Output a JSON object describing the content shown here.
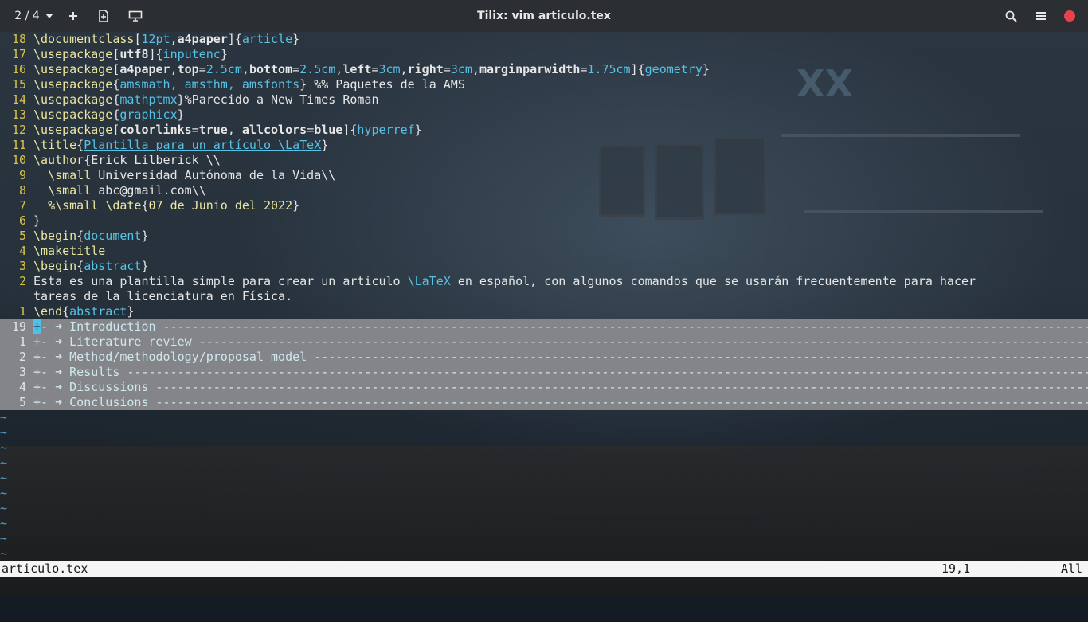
{
  "titlebar": {
    "tab_indicator": "2 / 4",
    "title": "Tilix: vim articulo.tex",
    "icons": [
      "chevron-down-icon",
      "plus-icon",
      "new-session-icon",
      "sync-icon",
      "search-icon",
      "menu-icon",
      "close-icon"
    ],
    "close_color": "#e8424a"
  },
  "editor": {
    "lines": [
      {
        "n": "18",
        "segs": [
          [
            "kw",
            "\\documentclass"
          ],
          [
            "t",
            "["
          ],
          [
            "arg",
            "12pt"
          ],
          [
            "t",
            ","
          ],
          [
            "bold",
            "a4paper"
          ],
          [
            "t",
            "]{"
          ],
          [
            "arg",
            "article"
          ],
          [
            "t",
            "}"
          ]
        ]
      },
      {
        "n": "17",
        "segs": [
          [
            "kw",
            "\\usepackage"
          ],
          [
            "t",
            "["
          ],
          [
            "bold",
            "utf8"
          ],
          [
            "t",
            "]{"
          ],
          [
            "arg",
            "inputenc"
          ],
          [
            "t",
            "}"
          ]
        ]
      },
      {
        "n": "16",
        "segs": [
          [
            "kw",
            "\\usepackage"
          ],
          [
            "t",
            "["
          ],
          [
            "bold",
            "a4paper"
          ],
          [
            "t",
            ","
          ],
          [
            "bold",
            "top"
          ],
          [
            "t",
            "="
          ],
          [
            "num",
            "2.5cm"
          ],
          [
            "t",
            ","
          ],
          [
            "bold",
            "bottom"
          ],
          [
            "t",
            "="
          ],
          [
            "num",
            "2.5cm"
          ],
          [
            "t",
            ","
          ],
          [
            "bold",
            "left"
          ],
          [
            "t",
            "="
          ],
          [
            "num",
            "3cm"
          ],
          [
            "t",
            ","
          ],
          [
            "bold",
            "right"
          ],
          [
            "t",
            "="
          ],
          [
            "num",
            "3cm"
          ],
          [
            "t",
            ","
          ],
          [
            "bold",
            "marginparwidth"
          ],
          [
            "t",
            "="
          ],
          [
            "num",
            "1.75cm"
          ],
          [
            "t",
            "]{"
          ],
          [
            "arg",
            "geometry"
          ],
          [
            "t",
            "}"
          ]
        ]
      },
      {
        "n": "15",
        "segs": [
          [
            "kw",
            "\\usepackage"
          ],
          [
            "t",
            "{"
          ],
          [
            "arg",
            "amsmath, amsthm, amsfonts"
          ],
          [
            "t",
            "} %% Paquetes de la AMS"
          ]
        ]
      },
      {
        "n": "14",
        "segs": [
          [
            "kw",
            "\\usepackage"
          ],
          [
            "t",
            "{"
          ],
          [
            "arg",
            "mathptmx"
          ],
          [
            "t",
            "}%Parecido a New Times Roman"
          ]
        ]
      },
      {
        "n": "13",
        "segs": [
          [
            "kw",
            "\\usepackage"
          ],
          [
            "t",
            "{"
          ],
          [
            "arg",
            "graphicx"
          ],
          [
            "t",
            "}"
          ]
        ]
      },
      {
        "n": "12",
        "segs": [
          [
            "kw",
            "\\usepackage"
          ],
          [
            "t",
            "["
          ],
          [
            "bold",
            "colorlinks"
          ],
          [
            "t",
            "="
          ],
          [
            "bold",
            "true"
          ],
          [
            "t",
            ", "
          ],
          [
            "bold",
            "allcolors"
          ],
          [
            "t",
            "="
          ],
          [
            "bold",
            "blue"
          ],
          [
            "t",
            "]{"
          ],
          [
            "arg",
            "hyperref"
          ],
          [
            "t",
            "}"
          ]
        ]
      },
      {
        "n": "11",
        "segs": [
          [
            "kw",
            "\\title"
          ],
          [
            "t",
            "{"
          ],
          [
            "link",
            "Plantilla para un artículo "
          ],
          [
            "link",
            "\\LaTeX"
          ],
          [
            "t",
            "}"
          ]
        ]
      },
      {
        "n": "10",
        "segs": [
          [
            "kw",
            "\\author"
          ],
          [
            "t",
            "{Erick Lilberick \\\\"
          ]
        ]
      },
      {
        "n": "9",
        "segs": [
          [
            "t",
            "  "
          ],
          [
            "kw",
            "\\small"
          ],
          [
            "t",
            " Universidad Autónoma de la Vida\\\\"
          ]
        ]
      },
      {
        "n": "8",
        "segs": [
          [
            "t",
            "  "
          ],
          [
            "kw",
            "\\small"
          ],
          [
            "t",
            " abc@gmail.com\\\\"
          ]
        ]
      },
      {
        "n": "7",
        "segs": [
          [
            "t",
            "  "
          ],
          [
            "kw",
            "%\\small \\date"
          ],
          [
            "t",
            "{"
          ],
          [
            "kw",
            "07 de Junio del 2022"
          ],
          [
            "t",
            "}"
          ]
        ]
      },
      {
        "n": "6",
        "segs": [
          [
            "t",
            "}"
          ]
        ]
      },
      {
        "n": "5",
        "segs": [
          [
            "kw",
            "\\begin"
          ],
          [
            "t",
            "{"
          ],
          [
            "arg",
            "document"
          ],
          [
            "t",
            "}"
          ]
        ]
      },
      {
        "n": "4",
        "segs": [
          [
            "kw",
            "\\maketitle"
          ]
        ]
      },
      {
        "n": "3",
        "segs": [
          [
            "kw",
            "\\begin"
          ],
          [
            "t",
            "{"
          ],
          [
            "arg",
            "abstract"
          ],
          [
            "t",
            "}"
          ]
        ]
      },
      {
        "n": "2",
        "segs": [
          [
            "t",
            "Esta es una plantilla simple para crear un articulo "
          ],
          [
            "arg",
            "\\LaTeX"
          ],
          [
            "t",
            " en español, con algunos comandos que se usarán frecuentemente para hacer"
          ]
        ]
      },
      {
        "n": "",
        "segs": [
          [
            "t",
            "tareas de la licenciatura en Física."
          ]
        ]
      },
      {
        "n": "1",
        "segs": [
          [
            "kw",
            "\\end"
          ],
          [
            "t",
            "{"
          ],
          [
            "arg",
            "abstract"
          ],
          [
            "t",
            "}"
          ]
        ]
      }
    ],
    "folds": [
      {
        "n": "19",
        "label": "Introduction",
        "cursor": true
      },
      {
        "n": "1",
        "label": "Literature review"
      },
      {
        "n": "2",
        "label": "Method/methodology/proposal model"
      },
      {
        "n": "3",
        "label": "Results"
      },
      {
        "n": "4",
        "label": "Discussions"
      },
      {
        "n": "5",
        "label": "Conclusions"
      }
    ],
    "fold_prefix": "+-",
    "fold_arrow": "➜",
    "tilde_count": 10,
    "tilde": "~"
  },
  "statusbar": {
    "filename": "articulo.tex",
    "position": "19,1",
    "scroll": "All"
  }
}
